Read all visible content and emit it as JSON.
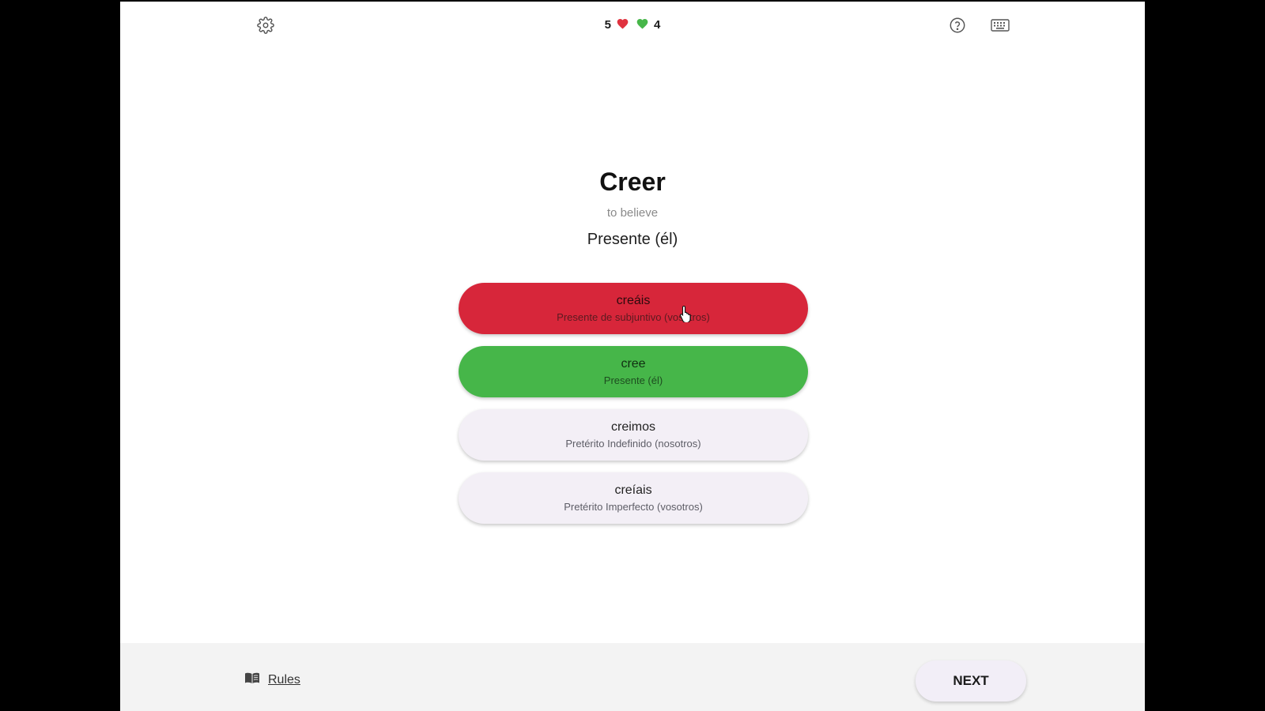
{
  "header": {
    "settings_icon": "gear-icon",
    "help_icon": "question-circle-icon",
    "keyboard_icon": "keyboard-icon",
    "score": {
      "wrong_count": "5",
      "correct_count": "4",
      "wrong_color": "#e0323f",
      "correct_color": "#46b649"
    }
  },
  "question": {
    "verb": "Creer",
    "translation": "to believe",
    "tense": "Presente (él)"
  },
  "options": [
    {
      "word": "creáis",
      "desc": "Presente de subjuntivo (vosotros)",
      "state": "wrong",
      "color": "#d7263a"
    },
    {
      "word": "cree",
      "desc": "Presente (él)",
      "state": "correct",
      "color": "#46b649"
    },
    {
      "word": "creimos",
      "desc": "Pretérito Indefinido (nosotros)",
      "state": "neutral",
      "color": "#f3eff6"
    },
    {
      "word": "creíais",
      "desc": "Pretérito Imperfecto (vosotros)",
      "state": "neutral",
      "color": "#f3eff6"
    }
  ],
  "footer": {
    "rules_label": "Rules",
    "rules_icon": "book-icon",
    "next_label": "NEXT"
  }
}
